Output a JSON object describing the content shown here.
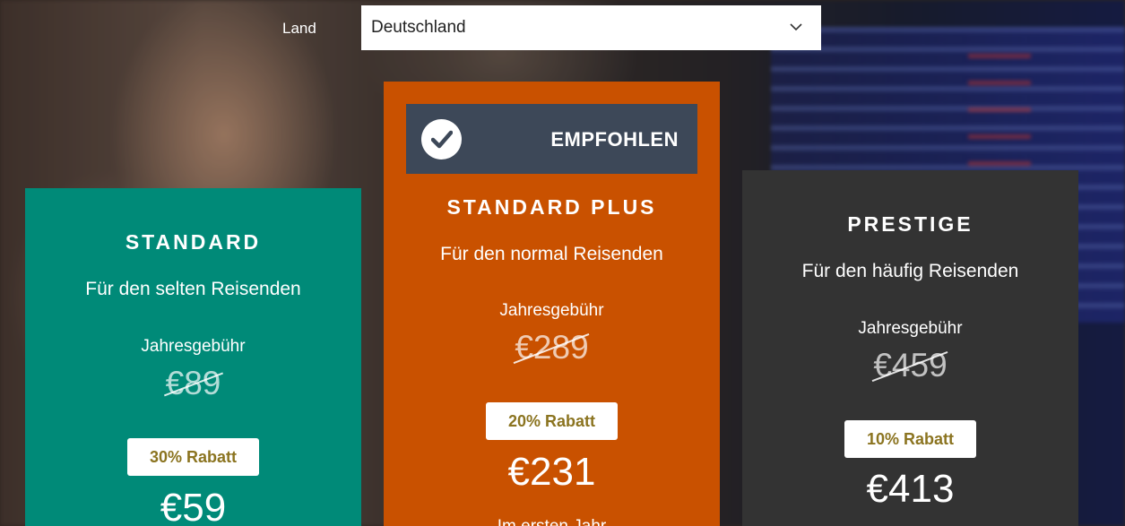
{
  "country": {
    "label": "Land",
    "selected": "Deutschland"
  },
  "plans": {
    "standard": {
      "title": "STANDARD",
      "subtitle": "Für den selten Reisenden",
      "fee_label": "Jahresgebühr",
      "old_price": "€89",
      "discount": "30% Rabatt",
      "new_price": "€59"
    },
    "plus": {
      "badge": "EMPFOHLEN",
      "title": "STANDARD PLUS",
      "subtitle": "Für den normal Reisenden",
      "fee_label": "Jahresgebühr",
      "old_price": "€289",
      "discount": "20% Rabatt",
      "new_price": "€231",
      "first_year": "Im ersten Jahr"
    },
    "prestige": {
      "title": "PRESTIGE",
      "subtitle": "Für den häufig Reisenden",
      "fee_label": "Jahresgebühr",
      "old_price": "€459",
      "discount": "10% Rabatt",
      "new_price": "€413"
    }
  },
  "colors": {
    "standard_card": "#008a78",
    "plus_card": "#c95100",
    "prestige_card": "#333333",
    "badge_bg": "#3d4858",
    "discount_text": "#8b7420"
  },
  "icons": {
    "select_chevron": "chevron-down-icon",
    "recommended": "check-circle-icon"
  }
}
